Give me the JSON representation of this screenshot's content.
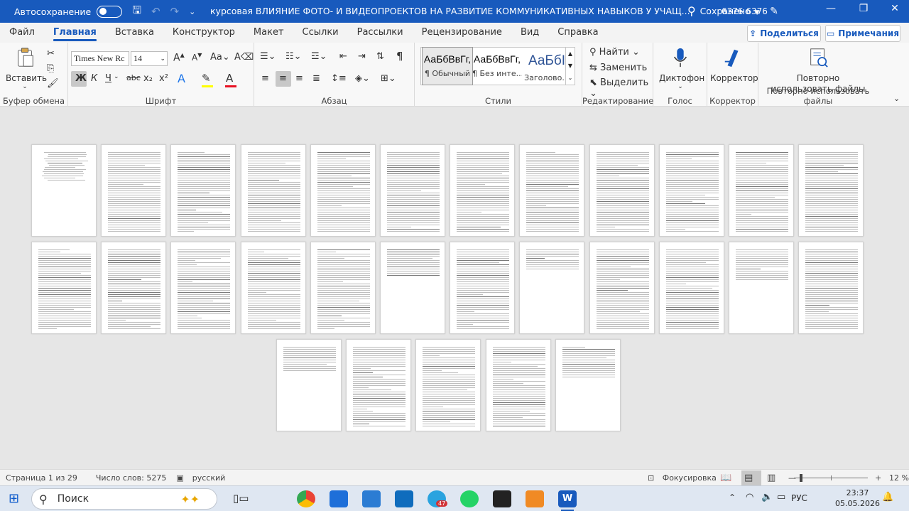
{
  "titlebar": {
    "autosave_label": "Автосохранение",
    "doc_title": "курсовая ВЛИЯНИЕ ФОТО- И ВИДЕОПРОЕКТОВ НА РАЗВИТИЕ КОММУНИКАТИВНЫХ НАВЫКОВ У УЧАЩ...",
    "save_status": "Сохранено",
    "user": "6376 6376"
  },
  "menu": {
    "tabs": [
      "Файл",
      "Главная",
      "Вставка",
      "Конструктор",
      "Макет",
      "Ссылки",
      "Рассылки",
      "Рецензирование",
      "Вид",
      "Справка"
    ],
    "share": "Поделиться",
    "comments": "Примечания"
  },
  "ribbon": {
    "paste": "Вставить",
    "clipboard": "Буфер обмена",
    "font_name": "Times New Rc",
    "font_size": "14",
    "font_group": "Шрифт",
    "paragraph_group": "Абзац",
    "styles": [
      {
        "sample": "АаБбВвГг,",
        "name": "¶ Обычный"
      },
      {
        "sample": "АаБбВвГг,",
        "name": "¶ Без инте..."
      },
      {
        "sample": "АаБбІ",
        "name": "Заголово..."
      }
    ],
    "styles_group": "Стили",
    "find": "Найти",
    "replace": "Заменить",
    "select": "Выделить",
    "editing_group": "Редактирование",
    "dictation": "Диктофон",
    "voice_group": "Голос",
    "editor": "Корректор",
    "editor_group": "Корректор",
    "reuse": "Повторно использовать файлы",
    "reuse_group": "Повторно использовать файлы",
    "bold": "Ж",
    "italic": "К",
    "underline": "Ч",
    "strike": "abc",
    "sub": "x₂",
    "sup": "x²"
  },
  "status": {
    "page": "Страница 1 из 29",
    "words": "Число слов: 5275",
    "lang": "русский",
    "focus": "Фокусировка",
    "zoom": "12 %"
  },
  "taskbar": {
    "search": "Поиск",
    "lang": "РУС",
    "time": "23:37",
    "date": "05.05.2026",
    "badge": "47"
  },
  "colors": {
    "accent": "#185abd",
    "highlight": "#ffff00",
    "font_color": "#e81123"
  },
  "document": {
    "total_pages": 29,
    "rows": [
      12,
      12,
      5
    ]
  }
}
